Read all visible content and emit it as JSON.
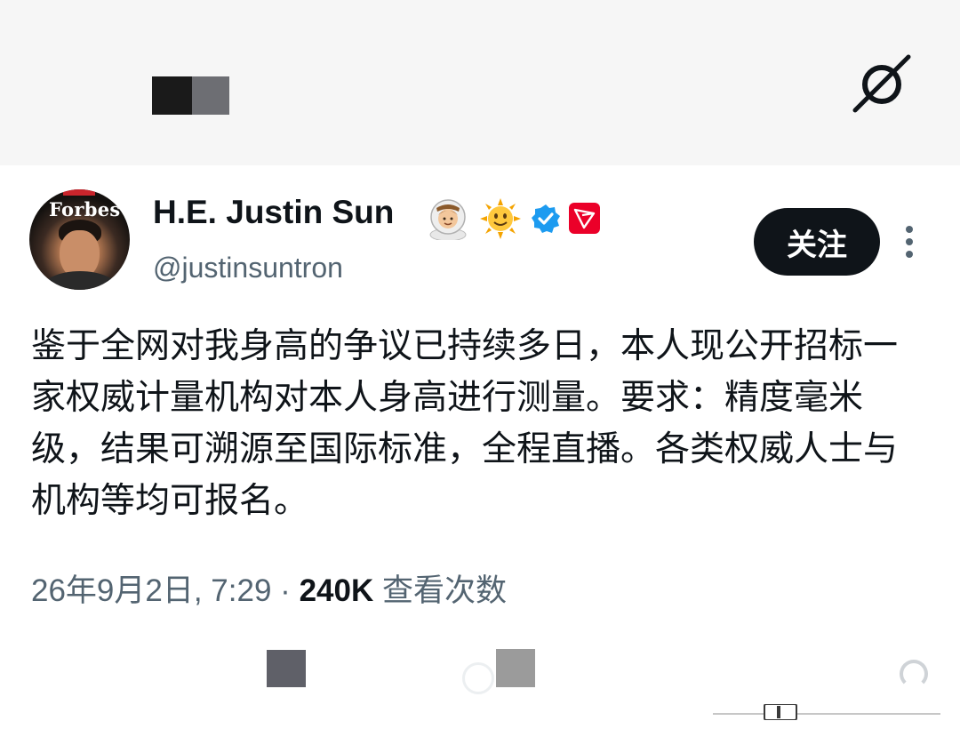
{
  "tweet": {
    "author": {
      "display_name": "H.E. Justin Sun",
      "handle": "@justinsuntron",
      "avatar_masthead": "Forbes",
      "badges": [
        "astronaut-emoji",
        "sun-emoji",
        "verified-icon",
        "tron-icon"
      ]
    },
    "follow_label": "关注",
    "text": "鉴于全网对我身高的争议已持续多日，本人现公开招标一家权威计量机构对本人身高进行测量。要求：精度毫米级，结果可溯源至国际标准，全程直播。各类权威人士与机构等均可报名。",
    "timestamp": "26年9月2日, 7:29",
    "separator": "·",
    "views": "240K",
    "views_label": "查看次数"
  },
  "colors": {
    "text_primary": "#0f1419",
    "text_secondary": "#536471",
    "verified_blue": "#1d9bf0",
    "tron_red": "#eb0029"
  }
}
